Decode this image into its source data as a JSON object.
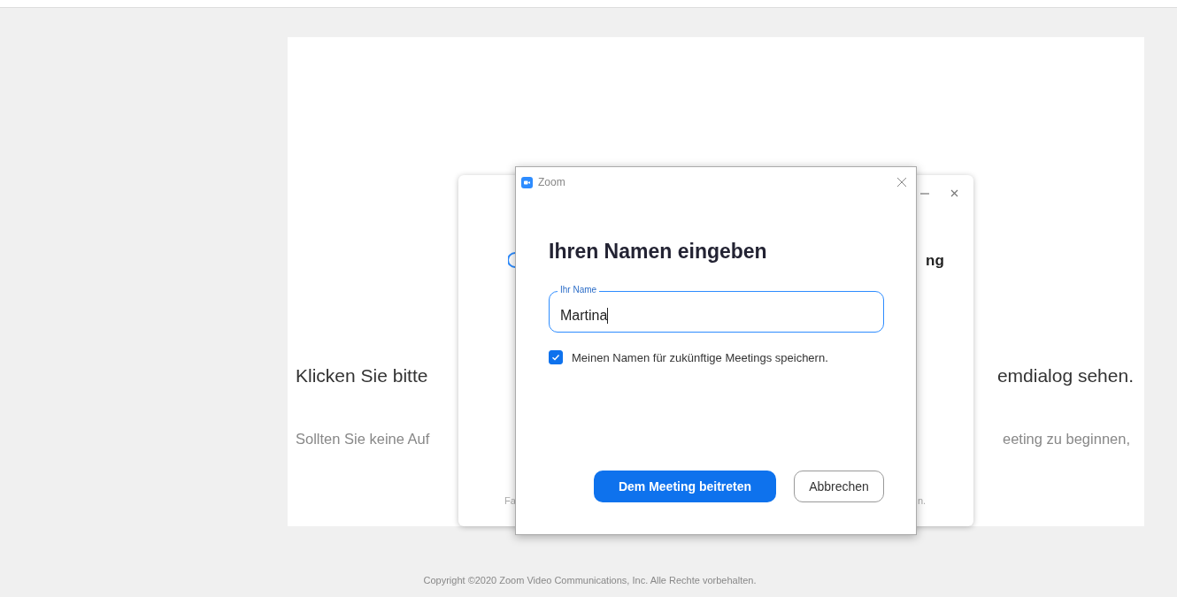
{
  "page": {
    "instruction_left": "Klicken Sie bitte",
    "instruction_right": "emdialog sehen.",
    "note_left": "Sollten Sie keine Auf",
    "note_right": "eeting zu beginnen,",
    "copyright": "Copyright ©2020 Zoom Video Communications, Inc. Alle Rechte vorbehalten."
  },
  "back_window": {
    "heading_fragment": "ng",
    "footer_left": "Fa",
    "footer_right": "n."
  },
  "dialog": {
    "title": "Zoom",
    "heading": "Ihren Namen eingeben",
    "name_field": {
      "label": "Ihr Name",
      "value": "Martina",
      "focused": true
    },
    "remember": {
      "label": "Meinen Namen für zukünftige Meetings speichern.",
      "checked": true
    },
    "buttons": [
      {
        "label": "Dem Meeting beitreten",
        "kind": "primary"
      },
      {
        "label": "Abbrechen",
        "kind": "secondary"
      }
    ]
  }
}
